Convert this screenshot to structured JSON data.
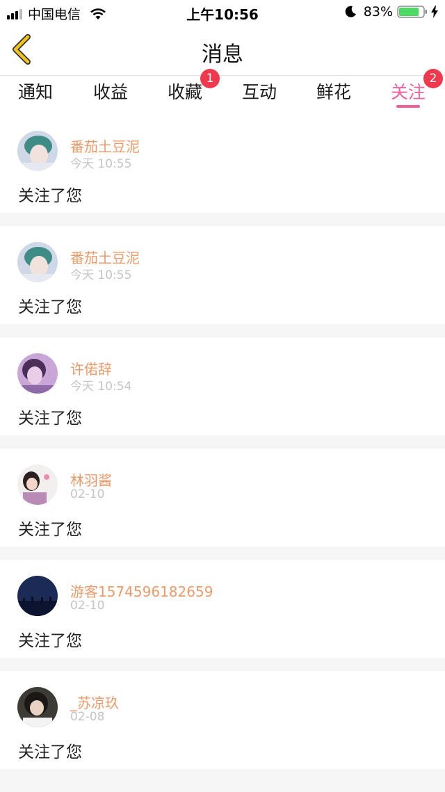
{
  "status_bar": {
    "carrier": "中国电信",
    "time": "上午10:56",
    "battery_percent": "83%",
    "battery_level": 0.83
  },
  "header": {
    "title": "消息",
    "back_icon": "chevron-left-icon"
  },
  "tabs": [
    {
      "label": "通知",
      "badge": ""
    },
    {
      "label": "收益",
      "badge": ""
    },
    {
      "label": "收藏",
      "badge": "1"
    },
    {
      "label": "互动",
      "badge": ""
    },
    {
      "label": "鲜花",
      "badge": ""
    },
    {
      "label": "关注",
      "badge": "2",
      "active": true
    }
  ],
  "colors": {
    "accent": "#ef5f9a",
    "username": "#ed9a6a",
    "badge": "#f0394d",
    "back_icon": "#f0c419"
  },
  "notifications": [
    {
      "name": "番茄土豆泥",
      "time": "今天 10:55",
      "message": "关注了您",
      "avatar": "green-hair-avatar"
    },
    {
      "name": "番茄土豆泥",
      "time": "今天 10:55",
      "message": "关注了您",
      "avatar": "green-hair-avatar"
    },
    {
      "name": "许偌辞",
      "time": "今天 10:54",
      "message": "关注了您",
      "avatar": "purple-girl-avatar"
    },
    {
      "name": "林羽酱",
      "time": "02-10",
      "message": "关注了您",
      "avatar": "girl-pink-avatar"
    },
    {
      "name": "游客1574596182659",
      "time": "02-10",
      "message": "关注了您",
      "avatar": "night-sky-avatar"
    },
    {
      "name": "_苏凉玖",
      "time": "02-08",
      "message": "关注了您",
      "avatar": "dark-girl-avatar"
    }
  ]
}
